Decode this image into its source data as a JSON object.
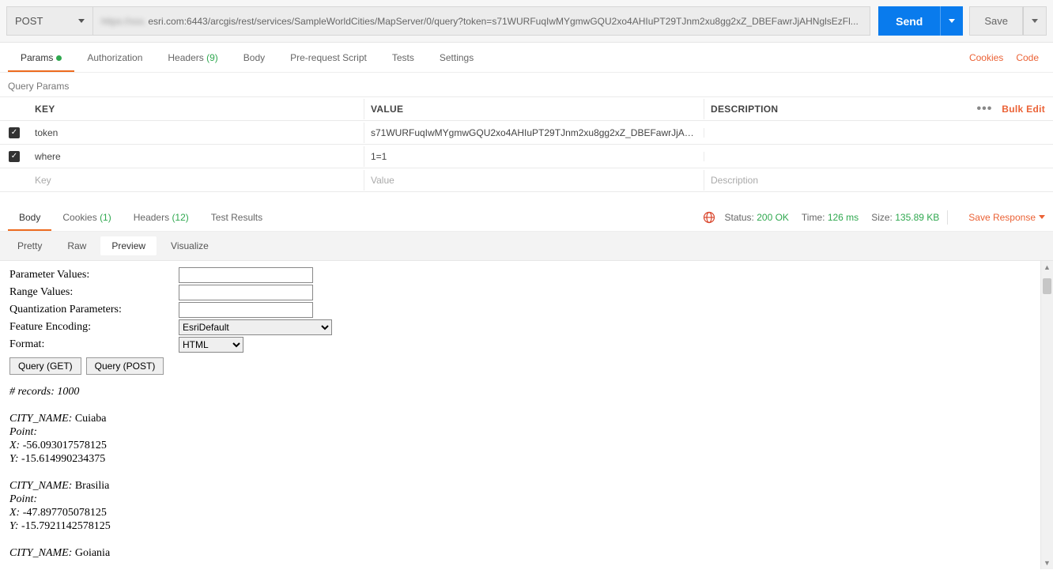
{
  "request": {
    "method": "POST",
    "url_visible": "esri.com:6443/arcgis/rest/services/SampleWorldCities/MapServer/0/query?token=s71WURFuqIwMYgmwGQU2xo4AHIuPT29TJnm2xu8gg2xZ_DBEFawrJjAHNglsEzFl...",
    "send_label": "Send",
    "save_label": "Save"
  },
  "tabs": {
    "params": "Params",
    "authorization": "Authorization",
    "headers": "Headers",
    "headers_count": "(9)",
    "body": "Body",
    "prerequest": "Pre-request Script",
    "tests": "Tests",
    "settings": "Settings",
    "cookies_link": "Cookies",
    "code_link": "Code"
  },
  "params_section": {
    "title": "Query Params",
    "col_key": "Key",
    "col_value": "Value",
    "col_desc": "Description",
    "bulk_edit": "Bulk Edit",
    "rows": [
      {
        "key": "token",
        "value": "s71WURFuqIwMYgmwGQU2xo4AHIuPT29TJnm2xu8gg2xZ_DBEFawrJjAH...",
        "desc": ""
      },
      {
        "key": "where",
        "value": "1=1",
        "desc": ""
      }
    ],
    "placeholder_key": "Key",
    "placeholder_value": "Value",
    "placeholder_desc": "Description"
  },
  "response_tabs": {
    "body": "Body",
    "cookies": "Cookies",
    "cookies_count": "(1)",
    "headers": "Headers",
    "headers_count": "(12)",
    "test_results": "Test Results",
    "status_label": "Status:",
    "status_value": "200 OK",
    "time_label": "Time:",
    "time_value": "126 ms",
    "size_label": "Size:",
    "size_value": "135.89 KB",
    "save_response": "Save Response"
  },
  "view_modes": {
    "pretty": "Pretty",
    "raw": "Raw",
    "preview": "Preview",
    "visualize": "Visualize"
  },
  "preview": {
    "param_values_label": "Parameter Values:",
    "range_values_label": "Range Values:",
    "quant_params_label": "Quantization Parameters:",
    "feature_encoding_label": "Feature Encoding:",
    "feature_encoding_value": "EsriDefault",
    "format_label": "Format:",
    "format_value": "HTML",
    "query_get": "Query (GET)",
    "query_post": "Query (POST)",
    "records_label": "# records: ",
    "records_count": "1000",
    "records": [
      {
        "city_name": "Cuiaba",
        "geom": "Point:",
        "x": "-56.093017578125",
        "y": "-15.614990234375"
      },
      {
        "city_name": "Brasilia",
        "geom": "Point:",
        "x": "-47.897705078125",
        "y": "-15.7921142578125"
      },
      {
        "city_name": "Goiania",
        "geom": "",
        "x": "",
        "y": ""
      }
    ],
    "city_name_key": "CITY_NAME:",
    "x_key": "X:",
    "y_key": "Y:"
  }
}
